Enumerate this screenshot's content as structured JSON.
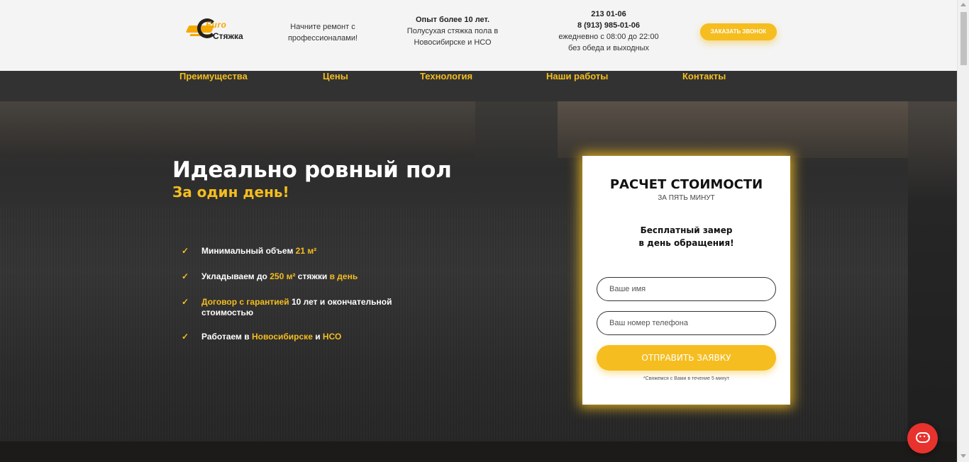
{
  "header": {
    "logo": {
      "euro": "Euro",
      "name": "Стяжка"
    },
    "tagline_line1": "Начните ремонт с",
    "tagline_line2": "профессионалами!",
    "experience_title": "Опыт более 10 лет.",
    "experience_line1": "Полусухая стяжка пола в",
    "experience_line2": "Новосибирске и НСО",
    "phone1": "213 01-06",
    "phone2": "8 (913) 985-01-06",
    "hours_line1": "ежедневно с 08:00 до 22:00",
    "hours_line2": "без обеда и выходных",
    "call_button": "Заказать звонок"
  },
  "nav": {
    "items": [
      "Преимущества",
      "Цены",
      "Технология",
      "Наши работы",
      "Контакты"
    ]
  },
  "hero": {
    "title": "Идеально ровный пол",
    "subtitle": "За один день!",
    "features": [
      {
        "parts": [
          "Минимальный объем ",
          "21 м²"
        ]
      },
      {
        "parts": [
          "Укладываем до ",
          "250 м²",
          " стяжки ",
          "в день"
        ]
      },
      {
        "parts": [
          "Договор с гарантией",
          " 10 лет и окончательной стоимостью"
        ]
      },
      {
        "parts": [
          "Работаем в ",
          "Новосибирске",
          " и ",
          "НСО"
        ]
      }
    ]
  },
  "form": {
    "title": "РАСЧЕТ СТОИМОСТИ",
    "subtitle": "ЗА ПЯТЬ МИНУТ",
    "note_line1": "Бесплатный замер",
    "note_line2": "в день обращения!",
    "name_placeholder": "Ваше имя",
    "phone_placeholder": "Ваш номер телефона",
    "submit": "Отправить заявку",
    "footnote": "*Свяжемся с Вами в течение 5 минут"
  },
  "colors": {
    "accent": "#f5bd1f",
    "nav_bg": "#323232",
    "chat": "#e8322e"
  },
  "icons": [
    "check-icon",
    "chat-icon"
  ]
}
